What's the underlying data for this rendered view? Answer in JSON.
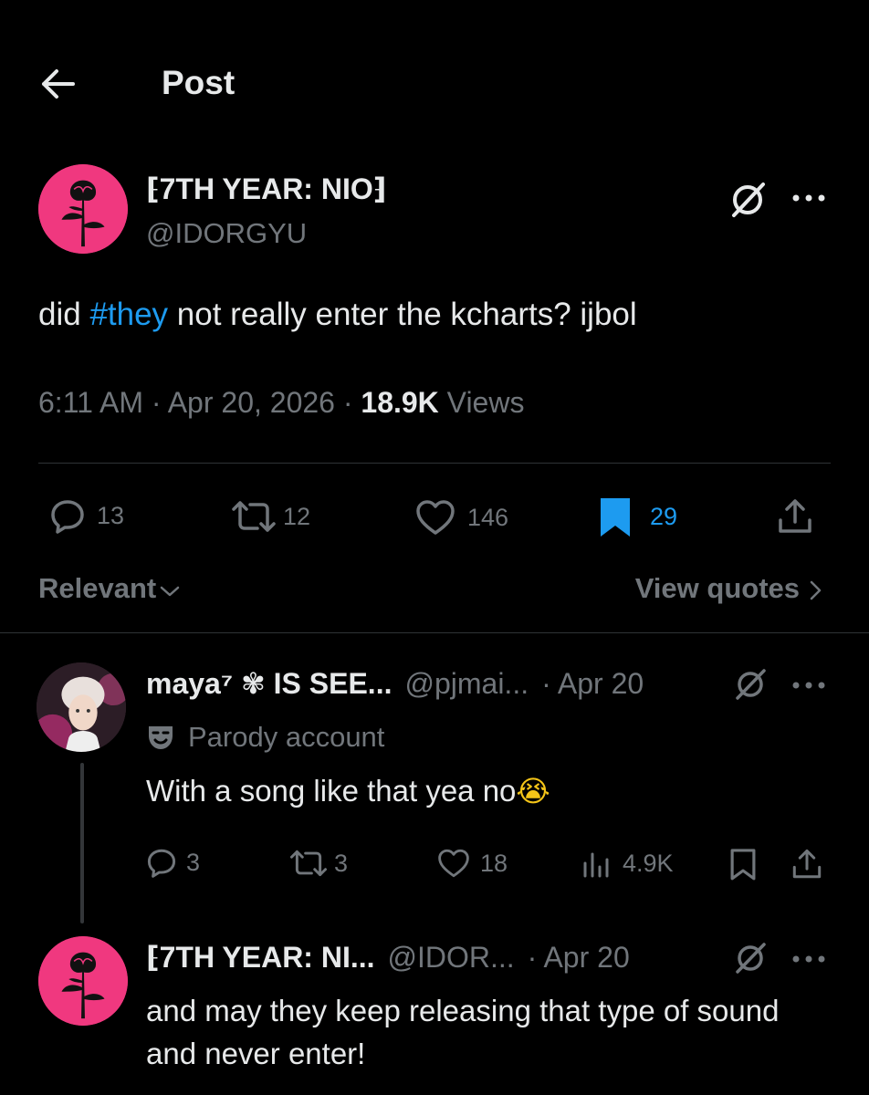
{
  "header": {
    "title": "Post"
  },
  "post": {
    "author_name": "⁅7TH YEAR: NIO⁆",
    "author_handle": "@IDORGYU",
    "text_before": "did ",
    "hashtag": "#they",
    "text_after": " not really enter the kcharts? ijbol",
    "time": "6:11 AM · Apr 20, 2026 · ",
    "views_count": "18.9K",
    "views_label": " Views",
    "replies": "13",
    "reposts": "12",
    "likes": "146",
    "bookmarks": "29"
  },
  "sort": {
    "label": "Relevant",
    "quotes_label": "View quotes"
  },
  "replies": [
    {
      "name": "maya⁷ ✾ IS SEE...",
      "handle": "@pjmai...",
      "date": "· Apr 20",
      "parody_label": "Parody account",
      "text": "With a song like that yea no",
      "emoji": "😭",
      "replies": "3",
      "reposts": "3",
      "likes": "18",
      "views": "4.9K"
    },
    {
      "name": "⁅7TH YEAR: NI...",
      "handle": "@IDOR...",
      "date": "· Apr 20",
      "text": "and may they keep releasing that type of sound and never enter!"
    }
  ],
  "colors": {
    "accent": "#1d9bf0",
    "muted": "#71767b",
    "avatar_pink": "#f0387f"
  },
  "icons": [
    "back-arrow-icon",
    "grok-icon",
    "more-icon",
    "reply-icon",
    "repost-icon",
    "like-icon",
    "bookmark-icon",
    "share-icon",
    "views-icon",
    "chevron-down-icon",
    "chevron-right-icon",
    "parody-mask-icon"
  ]
}
